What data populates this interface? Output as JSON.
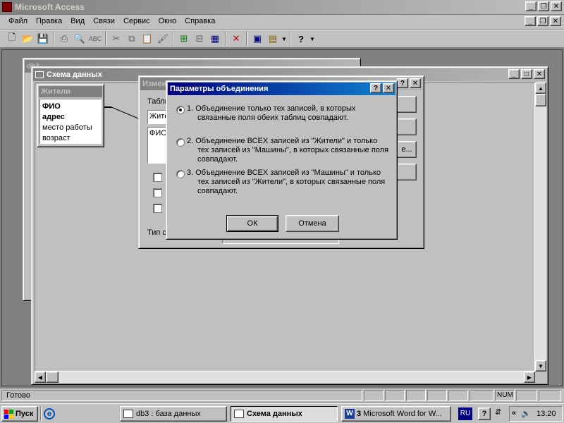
{
  "app": {
    "title": "Microsoft Access"
  },
  "menu": [
    "Файл",
    "Правка",
    "Вид",
    "Связи",
    "Сервис",
    "Окно",
    "Справка"
  ],
  "toolbar": {
    "icons": [
      "new-file-icon",
      "open-folder-icon",
      "save-icon",
      "print-icon",
      "print-preview-icon",
      "spelling-icon",
      "cut-icon",
      "copy-icon",
      "paste-icon",
      "format-painter-icon",
      "show-table-icon",
      "show-direct-icon",
      "show-all-icon",
      "delete-icon",
      "database-window-icon",
      "new-object-icon",
      "help-icon"
    ]
  },
  "schema_window": {
    "title": "Схема данных"
  },
  "db_window_title": "db3",
  "table_box": {
    "title": "Жители",
    "fields": [
      "ФИО",
      "адрес",
      "место работы",
      "возраст"
    ]
  },
  "edit_dialog": {
    "title": "Измен",
    "table_label": "Табли",
    "combo_value": "Жите",
    "grid_value": "ФИО",
    "type_label": "Тип с",
    "button_text": "е..."
  },
  "join_dialog": {
    "title": "Параметры объединения",
    "options": [
      {
        "line1": "1. Объединение только тех записей, в которых",
        "line2": "связанные поля обеих таблиц совпадают.",
        "line3": "",
        "selected": true
      },
      {
        "line1": "2. Объединение ВСЕХ записей из \"Жители\" и только",
        "line2": "тех записей из \"Машины\", в которых связанные поля",
        "line3": "совпадают.",
        "selected": false
      },
      {
        "line1": "3. Объединение ВСЕХ записей из \"Машины\" и только",
        "line2": "тех записей из \"Жители\", в которых связанные поля",
        "line3": "совпадают.",
        "selected": false
      }
    ],
    "ok_label": "ОК",
    "cancel_label": "Отмена"
  },
  "status": {
    "text": "Готово",
    "num": "NUM"
  },
  "taskbar": {
    "start_label": "Пуск",
    "tasks": [
      "db3 : база данных",
      "Схема данных",
      "Microsoft Word for W..."
    ],
    "lang": "RU",
    "clock": "13:20"
  }
}
